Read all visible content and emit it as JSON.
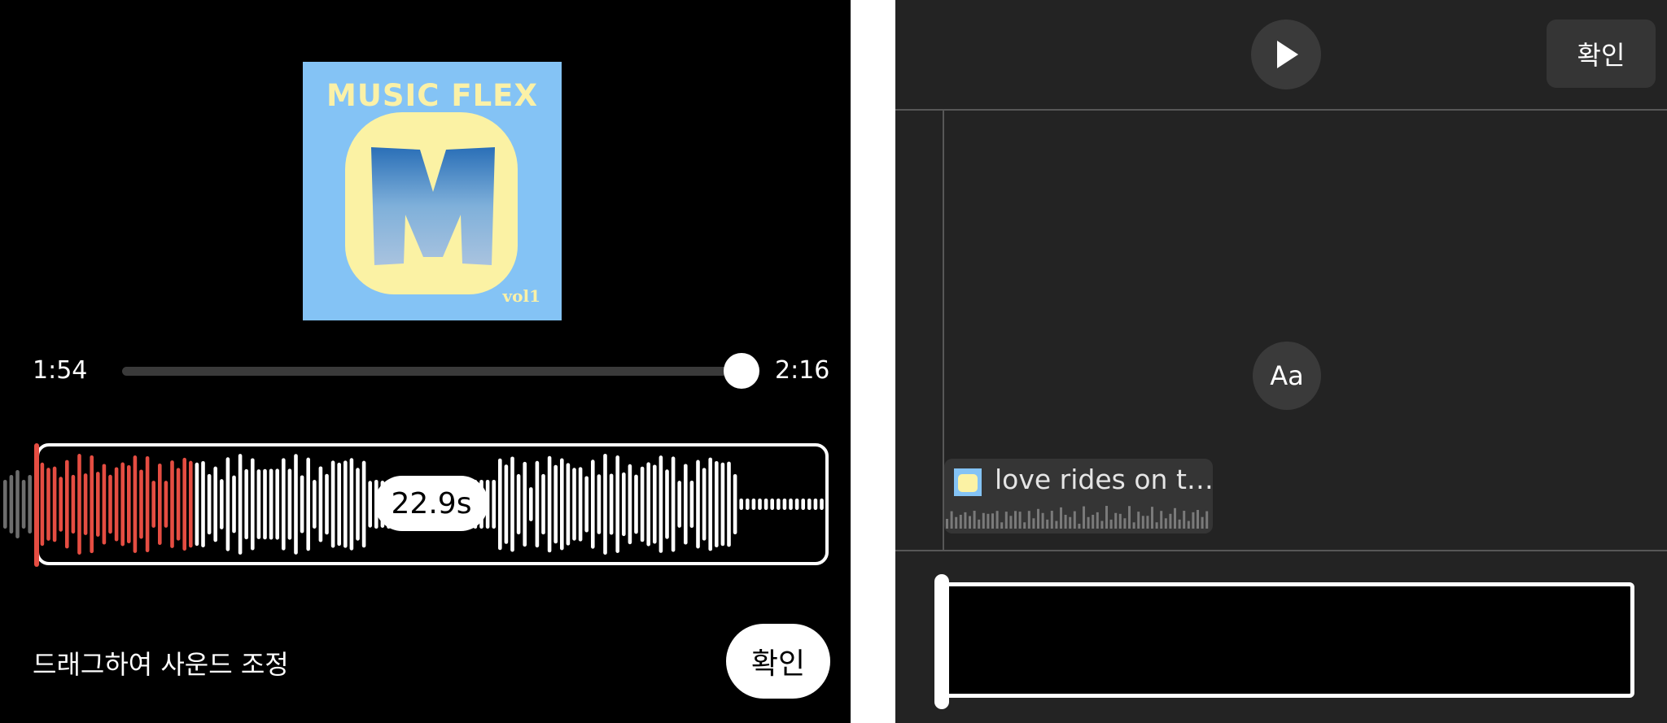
{
  "player": {
    "album": {
      "title": "MUSIC FLEX",
      "letter": "M",
      "volume": "vol1"
    },
    "time_current": "1:54",
    "time_total": "2:16",
    "clip_duration": "22.9s",
    "hint": "드래그하여 사운드 조정",
    "confirm_label": "확인"
  },
  "editor": {
    "confirm_label": "확인",
    "text_tool_label": "Aa",
    "track_label": "love rides on t…",
    "icons": [
      "play-icon",
      "album-thumbnail-icon"
    ]
  },
  "colors": {
    "background": "#000000",
    "editor_background": "#232323",
    "accent_red": "#e54d42",
    "album_blue": "#84c3f5",
    "album_yellow": "#fbf2a4"
  }
}
